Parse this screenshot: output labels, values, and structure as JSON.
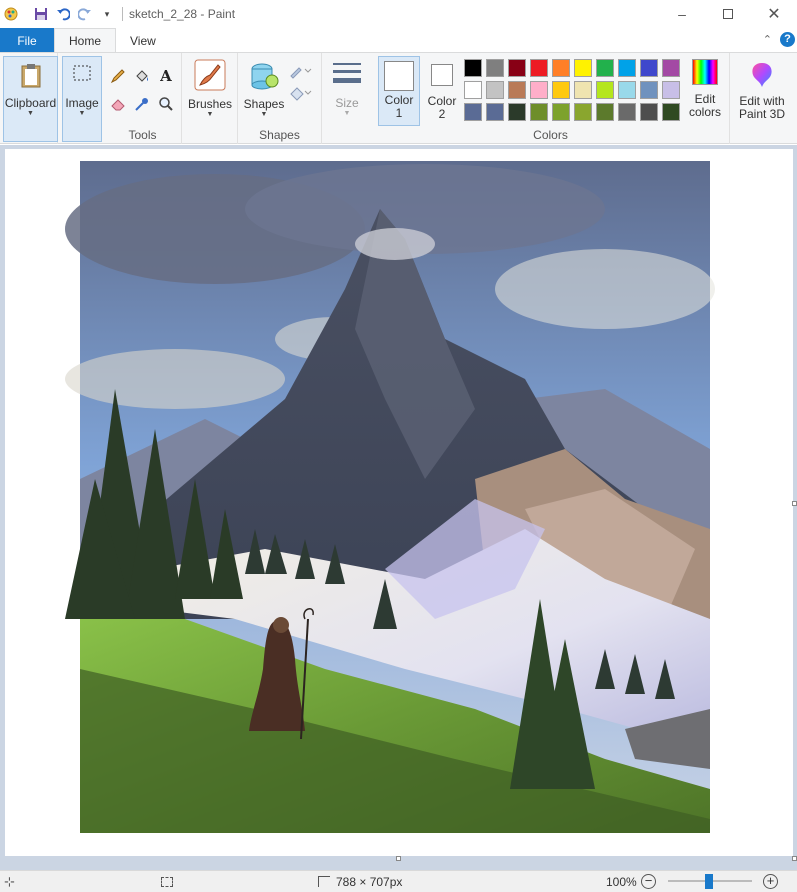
{
  "window": {
    "title": "sketch_2_28 - Paint",
    "minimize_icon": "minimize-icon",
    "maximize_icon": "maximize-icon",
    "close_icon": "close-icon"
  },
  "quick_access": {
    "icons": [
      "paint-app-icon",
      "save-icon",
      "undo-icon",
      "redo-icon",
      "customize-dropdown-icon"
    ]
  },
  "tabs": {
    "file": "File",
    "home": "Home",
    "view": "View"
  },
  "ribbon": {
    "clipboard": {
      "label": "Clipboard"
    },
    "image": {
      "label": "Image"
    },
    "tools": {
      "group_label": "Tools"
    },
    "brushes": {
      "label": "Brushes"
    },
    "shapes": {
      "label": "Shapes",
      "group_label": "Shapes"
    },
    "size": {
      "label": "Size"
    },
    "color1": {
      "line1": "Color",
      "line2": "1"
    },
    "color2": {
      "line1": "Color",
      "line2": "2"
    },
    "colors": {
      "group_label": "Colors",
      "palette_row1": [
        "#000000",
        "#7f7f7f",
        "#880015",
        "#ed1c24",
        "#ff7f27",
        "#fff200",
        "#22b14c",
        "#00a2e8",
        "#3f48cc",
        "#a349a4"
      ],
      "palette_row2": [
        "#ffffff",
        "#c3c3c3",
        "#b97a57",
        "#ffaec9",
        "#ffc90e",
        "#efe4b0",
        "#b5e61d",
        "#99d9ea",
        "#7092be",
        "#c8bfe7"
      ],
      "palette_row3": [
        "#5a6b95",
        "#5a6b95",
        "#2b3a2a",
        "#6e8e2a",
        "#7da22c",
        "#8aa62e",
        "#5c7a2c",
        "#6a6a6a",
        "#4e4e4e",
        "#2f4a22"
      ],
      "edit_line1": "Edit",
      "edit_line2": "colors"
    },
    "paint3d": {
      "line1": "Edit with",
      "line2": "Paint 3D"
    }
  },
  "status": {
    "image_size": "788 × 707px",
    "zoom": "100%"
  },
  "colors": {
    "accent": "#1979ca",
    "ribbon_bg": "#f5f6f7",
    "workspace_bg": "#cbd5e3"
  }
}
